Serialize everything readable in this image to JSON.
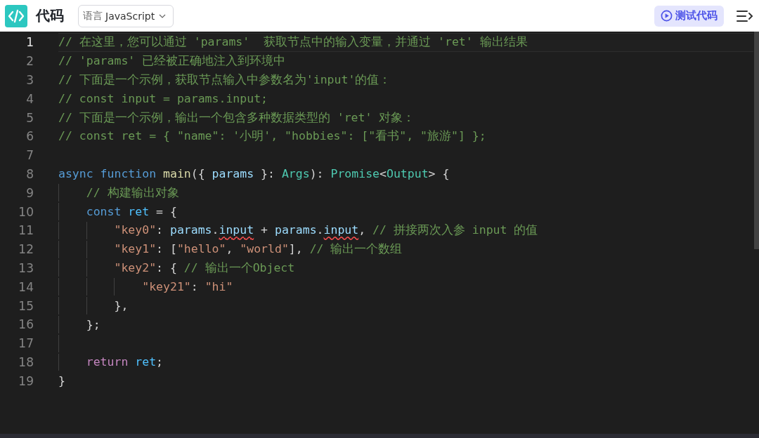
{
  "header": {
    "title": "代码",
    "language": {
      "label": "语言",
      "value": "JavaScript"
    },
    "run_button": "测试代码"
  },
  "editor": {
    "lines": [
      {
        "number": "1",
        "current": true,
        "tokens": [
          {
            "t": "// 在这里，您可以通过 'params'  获取节点中的输入变量，并通过 'ret' 输出结果",
            "kind": "comment"
          }
        ]
      },
      {
        "number": "2",
        "current": false,
        "tokens": [
          {
            "t": "// 'params' 已经被正确地注入到环境中",
            "kind": "comment"
          }
        ]
      },
      {
        "number": "3",
        "current": false,
        "tokens": [
          {
            "t": "// 下面是一个示例，获取节点输入中参数名为'input'的值：",
            "kind": "comment"
          }
        ]
      },
      {
        "number": "4",
        "current": false,
        "tokens": [
          {
            "t": "// const input = params.input;",
            "kind": "comment"
          }
        ]
      },
      {
        "number": "5",
        "current": false,
        "tokens": [
          {
            "t": "// 下面是一个示例，输出一个包含多种数据类型的 'ret' 对象：",
            "kind": "comment"
          }
        ]
      },
      {
        "number": "6",
        "current": false,
        "tokens": [
          {
            "t": "// const ret = { \"name\": '小明', \"hobbies\": [\"看书\", \"旅游\"] };",
            "kind": "comment"
          }
        ]
      },
      {
        "number": "7",
        "current": false
      },
      {
        "number": "8",
        "current": false,
        "tokens": [
          {
            "t": "async",
            "kind": "keyword"
          },
          {
            "t": " function",
            "kind": "keyword"
          },
          {
            "t": " main",
            "kind": "function"
          },
          {
            "t": "({ ",
            "kind": "plain"
          },
          {
            "t": "params",
            "kind": "variable"
          },
          {
            "t": " }: ",
            "kind": "plain"
          },
          {
            "t": "Args",
            "kind": "type"
          },
          {
            "t": "): ",
            "kind": "plain"
          },
          {
            "t": "Promise",
            "kind": "type"
          },
          {
            "t": "<",
            "kind": "plain"
          },
          {
            "t": "Output",
            "kind": "type"
          },
          {
            "t": "> {",
            "kind": "plain"
          }
        ]
      },
      {
        "number": "9",
        "current": false,
        "tokens": [
          {
            "t": "    // 构建输出对象",
            "kind": "comment"
          }
        ]
      },
      {
        "number": "10",
        "current": false,
        "tokens": [
          {
            "t": "    const",
            "kind": "keyword"
          },
          {
            "t": " ret",
            "kind": "constant"
          },
          {
            "t": " = {",
            "kind": "plain"
          }
        ]
      },
      {
        "number": "11",
        "current": false,
        "tokens": [
          {
            "t": "        \"key0\"",
            "kind": "string"
          },
          {
            "t": ": ",
            "kind": "plain"
          },
          {
            "t": "params",
            "kind": "variable"
          },
          {
            "t": ".",
            "kind": "plain"
          },
          {
            "t": "input",
            "kind": "warning"
          },
          {
            "t": " + ",
            "kind": "plain"
          },
          {
            "t": "params",
            "kind": "variable"
          },
          {
            "t": ".",
            "kind": "plain"
          },
          {
            "t": "input",
            "kind": "warning"
          },
          {
            "t": ", ",
            "kind": "plain"
          },
          {
            "t": "// 拼接两次入参 input 的值",
            "kind": "comment"
          }
        ]
      },
      {
        "number": "12",
        "current": false,
        "tokens": [
          {
            "t": "        \"key1\"",
            "kind": "string"
          },
          {
            "t": ": [",
            "kind": "plain"
          },
          {
            "t": "\"hello\"",
            "kind": "string"
          },
          {
            "t": ", ",
            "kind": "plain"
          },
          {
            "t": "\"world\"",
            "kind": "string"
          },
          {
            "t": "], ",
            "kind": "plain"
          },
          {
            "t": "// 输出一个数组",
            "kind": "comment"
          }
        ]
      },
      {
        "number": "13",
        "current": false,
        "tokens": [
          {
            "t": "        \"key2\"",
            "kind": "string"
          },
          {
            "t": ": { ",
            "kind": "plain"
          },
          {
            "t": "// 输出一个Object",
            "kind": "comment"
          }
        ]
      },
      {
        "number": "14",
        "current": false,
        "tokens": [
          {
            "t": "            \"key21\"",
            "kind": "string"
          },
          {
            "t": ": ",
            "kind": "plain"
          },
          {
            "t": "\"hi\"",
            "kind": "string"
          }
        ]
      },
      {
        "number": "15",
        "current": false,
        "tokens": [
          {
            "t": "        },",
            "kind": "plain"
          }
        ]
      },
      {
        "number": "16",
        "current": false,
        "tokens": [
          {
            "t": "    };",
            "kind": "plain"
          }
        ]
      },
      {
        "number": "17",
        "current": false
      },
      {
        "number": "18",
        "current": false,
        "tokens": [
          {
            "t": "    return",
            "kind": "control"
          },
          {
            "t": " ret",
            "kind": "constant"
          },
          {
            "t": ";",
            "kind": "plain"
          }
        ]
      },
      {
        "number": "19",
        "current": false,
        "tokens": [
          {
            "t": "}",
            "kind": "plain"
          }
        ]
      }
    ]
  }
}
